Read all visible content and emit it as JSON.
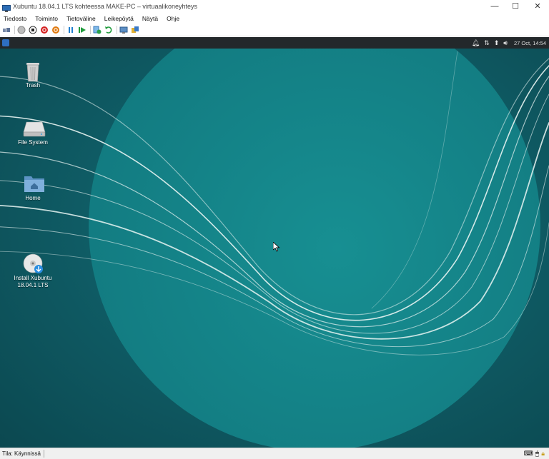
{
  "window": {
    "title": "Xubuntu 18.04.1 LTS kohteessa MAKE-PC – virtuaalikoneyhteys",
    "controls": {
      "minimize": "—",
      "maximize": "☐",
      "close": "✕"
    }
  },
  "menu": {
    "items": [
      "Tiedosto",
      "Toiminto",
      "Tietoväline",
      "Leikepöytä",
      "Näytä",
      "Ohje"
    ]
  },
  "toolbar": {
    "buttons": [
      "ctrl-alt-del-icon",
      "start-icon",
      "turn-off-icon",
      "shut-down-icon",
      "save-icon",
      "pause-icon",
      "resume-icon",
      "checkpoint-icon",
      "revert-icon",
      "enhanced-session-icon",
      "share-icon"
    ]
  },
  "guest": {
    "panel": {
      "clock": "27 Oct, 14:54",
      "tray_icons": [
        "bell-icon",
        "network-icon",
        "update-icon",
        "volume-icon"
      ]
    },
    "desktop_icons": [
      {
        "label": "Trash",
        "icon": "trash-icon"
      },
      {
        "label": "File System",
        "icon": "drive-icon"
      },
      {
        "label": "Home",
        "icon": "home-folder-icon"
      },
      {
        "label": "Install Xubuntu\n18.04.1 LTS",
        "icon": "install-disc-icon"
      }
    ],
    "colors": {
      "desktop_dark": "#0d4f56",
      "circle": "#15878c",
      "panel": "#23282b"
    }
  },
  "status": {
    "text": "Tila: Käynnissä"
  }
}
